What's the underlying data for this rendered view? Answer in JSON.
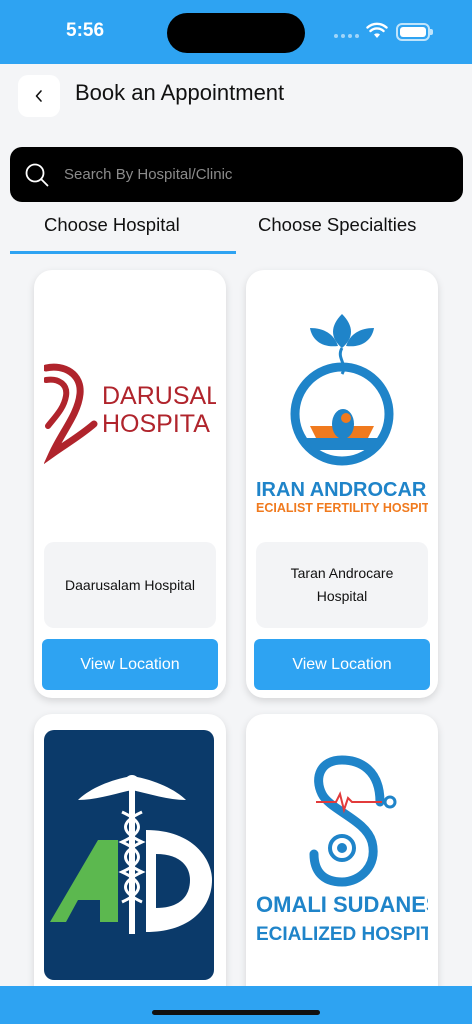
{
  "status": {
    "time": "5:56"
  },
  "header": {
    "title": "Book an Appointment",
    "back_icon": "chevron-left-icon"
  },
  "search": {
    "placeholder": "Search By Hospital/Clinic",
    "value": ""
  },
  "tabs": [
    {
      "label": "Choose Hospital",
      "active": true
    },
    {
      "label": "Choose Specialties",
      "active": false
    }
  ],
  "hospitals": [
    {
      "name": "Daarusalam Hospital",
      "button": "View Location",
      "logo_text": [
        "DARUSAL",
        "HOSPITA"
      ]
    },
    {
      "name": "Taran Androcare Hospital",
      "button": "View Location",
      "logo_text": [
        "IRAN ANDROCAR",
        "ECIALIST FERTILITY HOSPIT"
      ]
    },
    {
      "name": "",
      "button": "",
      "logo_text": []
    },
    {
      "name": "",
      "button": "",
      "logo_text": [
        "OMALI SUDANES",
        "ECIALIZED HOSPIT"
      ]
    }
  ],
  "colors": {
    "accent": "#2ea3f2",
    "dark_red": "#b0242c",
    "navy": "#0b3a6a",
    "green": "#5cb84f"
  }
}
